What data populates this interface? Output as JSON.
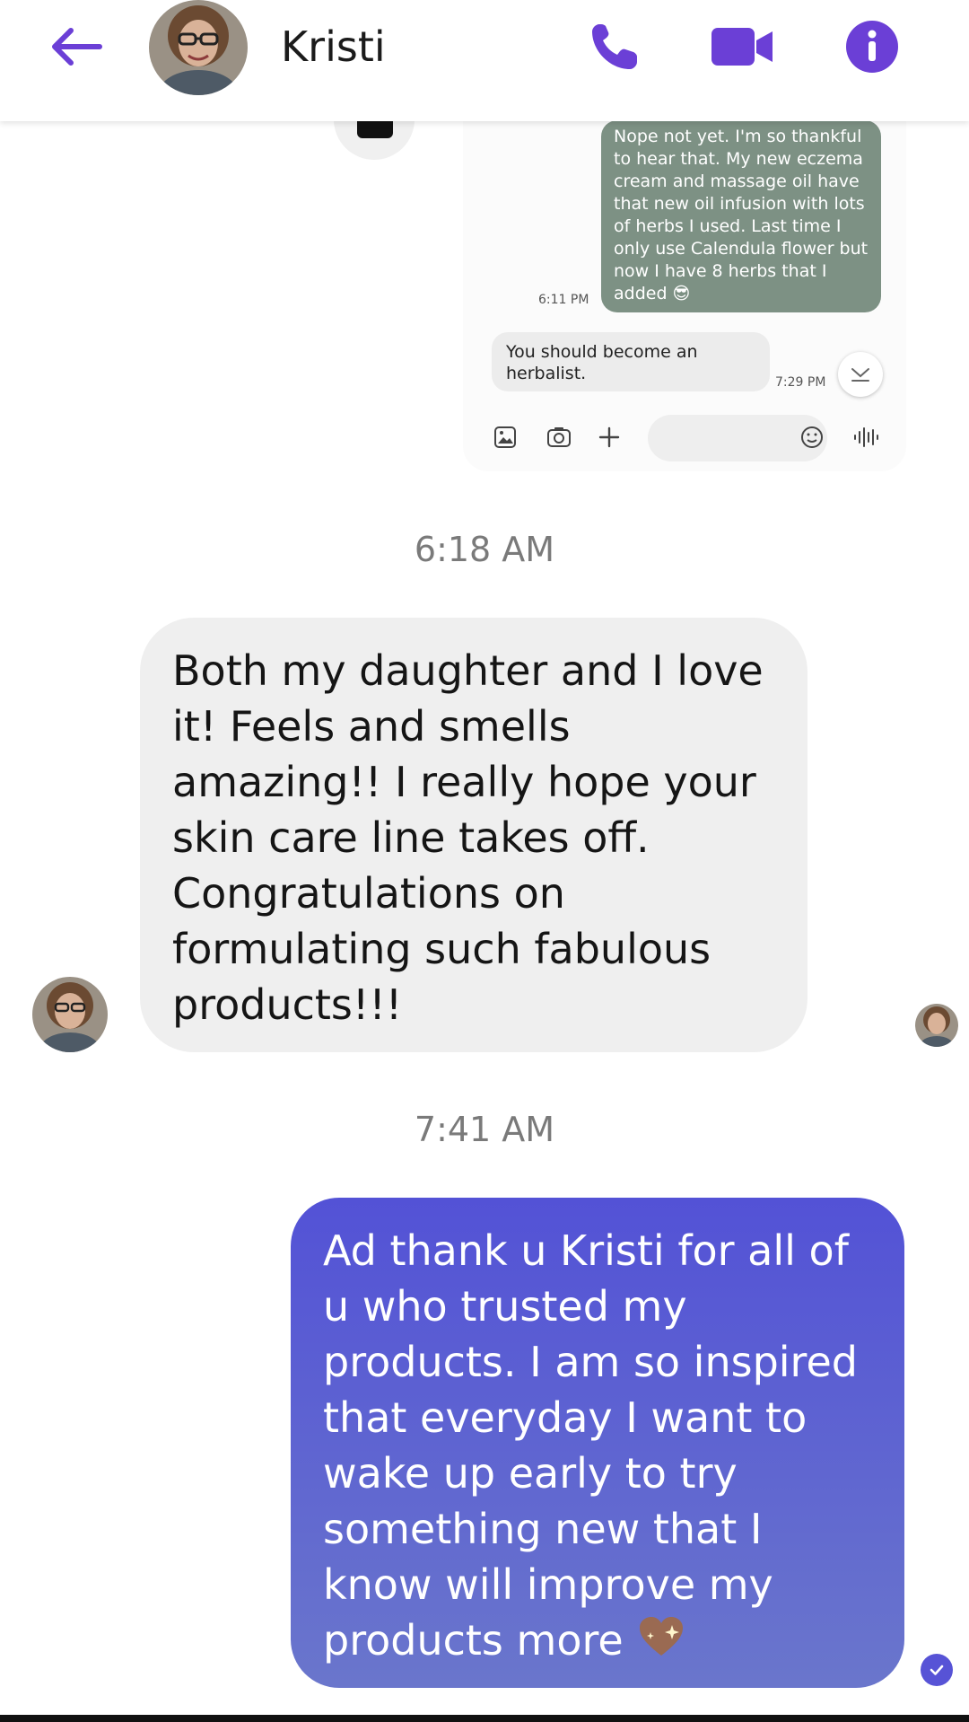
{
  "header": {
    "contact_name": "Kristi",
    "accent_color": "#6b3fd6"
  },
  "embedded_screenshot": {
    "incoming_message": "Nope not yet. I'm so thankful to hear that. My new eczema cream and massage oil have that new oil infusion with lots of herbs I used. Last time I only use Calendula flower but now I have 8 herbs that I added 😎",
    "incoming_time": "6:11 PM",
    "reply_message": "You should become an herbalist.",
    "reply_time": "7:29 PM"
  },
  "conversation": {
    "timestamp_1": "6:18 AM",
    "incoming_message": "Both my daughter and I love it! Feels and smells amazing!! I really hope your skin care line takes off. Congratulations on formulating such fabulous products!!!",
    "timestamp_2": "7:41 AM",
    "outgoing_message": "Ad thank u Kristi for all of u who trusted my products. I am so inspired that everyday I want to wake up early to try something new that I know will improve my products more",
    "outgoing_emoji": "💖",
    "outgoing_bubble_color": "#5a5fd4"
  }
}
